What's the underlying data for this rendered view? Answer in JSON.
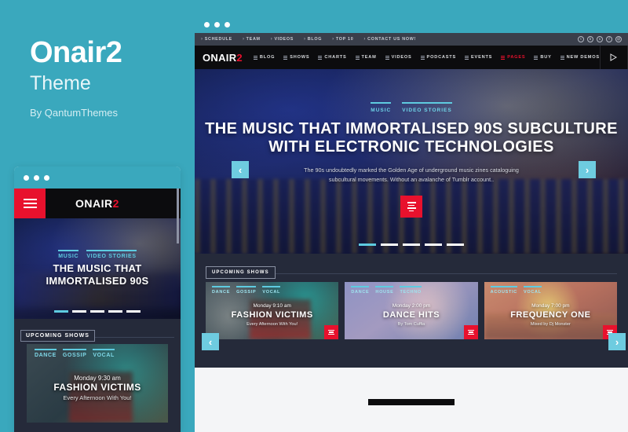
{
  "promo": {
    "title": "Onair2",
    "subtitle": "Theme",
    "byline": "By QantumThemes",
    "accent_teal": "#3aa8bd",
    "accent_red": "#e8112d"
  },
  "browser": {
    "topnav": {
      "links": [
        "SCHEDULE",
        "TEAM",
        "VIDEOS",
        "BLOG",
        "TOP 10",
        "CONTACT US NOW!"
      ],
      "socials": [
        "twitter-icon",
        "behance-icon",
        "soundcloud-icon",
        "facebook-icon",
        "mail-icon"
      ]
    },
    "mainnav": {
      "brand_text": "ONAIR",
      "brand_accent": "2",
      "links": [
        {
          "label": "BLOG",
          "active": false
        },
        {
          "label": "SHOWS",
          "active": false
        },
        {
          "label": "CHARTS",
          "active": false
        },
        {
          "label": "TEAM",
          "active": false
        },
        {
          "label": "VIDEOS",
          "active": false
        },
        {
          "label": "PODCASTS",
          "active": false
        },
        {
          "label": "EVENTS",
          "active": false
        },
        {
          "label": "PAGES",
          "active": true
        },
        {
          "label": "BUY",
          "active": false
        },
        {
          "label": "NEW DEMOS",
          "active": false
        }
      ],
      "icons": [
        "play-icon",
        "copy-icon",
        "search-icon"
      ]
    },
    "hero": {
      "categories": [
        "MUSIC",
        "VIDEO STORIES"
      ],
      "title_line1": "THE MUSIC THAT IMMORTALISED 90S SUBCULTURE",
      "title_line2": "WITH ELECTRONIC TECHNOLOGIES",
      "description": "The 90s undoubtedly marked the Golden Age of underground music zines cataloguing subcultural movements. Without an avalanche of Tumblr account..",
      "prev_label": "‹",
      "next_label": "›",
      "slides": 5,
      "active_slide": 1
    },
    "upcoming": {
      "section_label": "UPCOMING SHOWS",
      "prev_label": "‹",
      "next_label": "›",
      "cards": [
        {
          "tags": [
            "DANCE",
            "GOSSIP",
            "VOCAL"
          ],
          "time": "Monday 9:10 am",
          "name": "FASHION VICTIMS",
          "desc": "Every Afternoon With You!"
        },
        {
          "tags": [
            "DANCE",
            "HOUSE",
            "TECHNO"
          ],
          "time": "Monday 2:00 pm",
          "name": "DANCE HITS",
          "desc": "By Tom Cuffia"
        },
        {
          "tags": [
            "ACOUSTIC",
            "VOCAL"
          ],
          "time": "Monday 7:00 pm",
          "name": "FREQUENCY ONE",
          "desc": "Mixed by Dj Monster"
        }
      ]
    }
  },
  "mobile": {
    "brand_text": "ONAIR",
    "brand_accent": "2",
    "menu_icon": "hamburger-icon",
    "hero": {
      "categories": [
        "MUSIC",
        "VIDEO STORIES"
      ],
      "title_line1": "THE MUSIC THAT",
      "title_line2": "IMMORTALISED 90S",
      "slides": 5,
      "active_slide": 1
    },
    "upcoming": {
      "section_label": "UPCOMING SHOWS",
      "card": {
        "tags": [
          "DANCE",
          "GOSSIP",
          "VOCAL"
        ],
        "time": "Monday 9:30 am",
        "name": "FASHION VICTIMS",
        "desc": "Every Afternoon With You!"
      }
    }
  }
}
